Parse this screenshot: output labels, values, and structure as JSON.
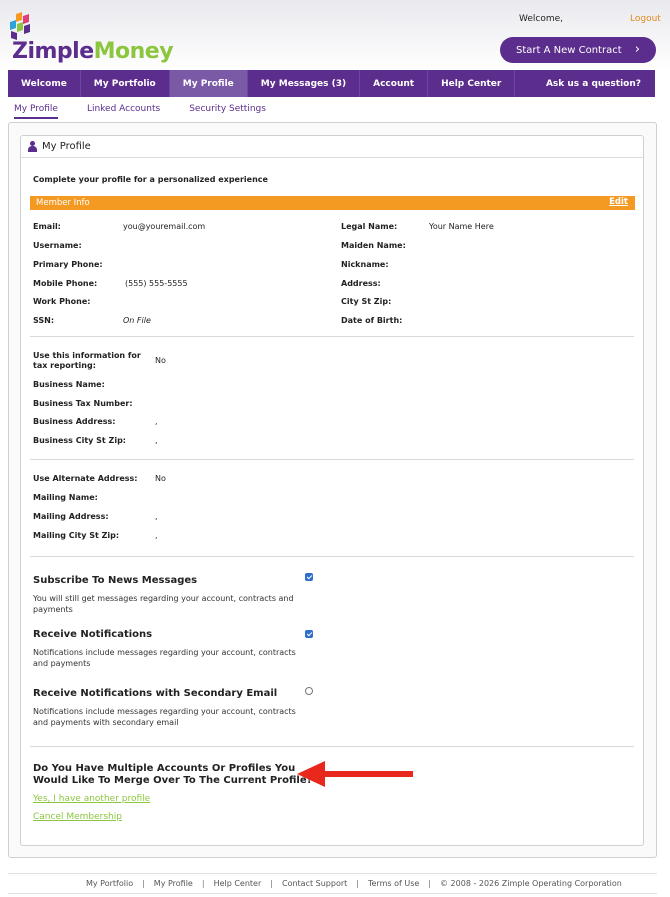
{
  "brand": {
    "name_part1": "Zimple",
    "name_part2": "Money",
    "colors": {
      "purple": "#5b2d8c",
      "green": "#8cc63f",
      "orange": "#f49a22",
      "link_orange": "#e08a1e"
    }
  },
  "header": {
    "welcome": "Welcome,",
    "logout": "Logout",
    "start_contract": "Start A New Contract",
    "start_icon": "chevron-right-icon"
  },
  "nav": {
    "items": [
      {
        "label": "Welcome"
      },
      {
        "label": "My Portfolio"
      },
      {
        "label": "My Profile",
        "active": true
      },
      {
        "label": "My Messages (3)"
      },
      {
        "label": "Account"
      },
      {
        "label": "Help Center"
      }
    ],
    "ask": "Ask us a question?"
  },
  "subtabs": [
    {
      "label": "My Profile",
      "active": true
    },
    {
      "label": "Linked Accounts"
    },
    {
      "label": "Security Settings"
    }
  ],
  "card": {
    "title": "My Profile",
    "icon": "user-icon",
    "intro": "Complete your profile for a personalized experience",
    "member_bar": {
      "label": "Member Info",
      "edit": "Edit"
    }
  },
  "member_left": [
    {
      "label": "Email:",
      "value": "you@youremail.com"
    },
    {
      "label": "Username:",
      "value": ""
    },
    {
      "label": "Primary Phone:",
      "value": ""
    },
    {
      "label": "Mobile Phone:",
      "value": "(555) 555-5555"
    },
    {
      "label": "Work Phone:",
      "value": ""
    },
    {
      "label": "SSN:",
      "value": "On File"
    }
  ],
  "member_right": [
    {
      "label": "Legal Name:",
      "value": "Your Name Here"
    },
    {
      "label": "Maiden Name:",
      "value": ""
    },
    {
      "label": "Nickname:",
      "value": ""
    },
    {
      "label": "Address:",
      "value": ""
    },
    {
      "label": "City St Zip:",
      "value": ""
    },
    {
      "label": "Date of Birth:",
      "value": ""
    }
  ],
  "business": [
    {
      "label": "Use this information for tax reporting:",
      "value": "No"
    },
    {
      "label": "Business Name:",
      "value": ""
    },
    {
      "label": "Business Tax Number:",
      "value": ""
    },
    {
      "label": "Business Address:",
      "value": ","
    },
    {
      "label": "Business City St Zip:",
      "value": ","
    }
  ],
  "mailing": [
    {
      "label": "Use Alternate Address:",
      "value": "No"
    },
    {
      "label": "Mailing Name:",
      "value": ""
    },
    {
      "label": "Mailing Address:",
      "value": ","
    },
    {
      "label": "Mailing City St Zip:",
      "value": ","
    }
  ],
  "prefs": [
    {
      "title": "Subscribe To News Messages",
      "desc": "You will still get messages regarding your account, contracts and payments",
      "checked": true
    },
    {
      "title": "Receive Notifications",
      "desc": "Notifications include messages regarding your account, contracts and payments",
      "checked": true
    },
    {
      "title": "Receive Notifications with Secondary Email",
      "desc": "Notifications include messages regarding your account, contracts and payments with secondary email",
      "checked": false
    }
  ],
  "merge": {
    "question": "Do You Have Multiple Accounts Or Profiles You Would Like To Merge Over To The Current Profile?",
    "yes_link": "Yes, I have another profile",
    "cancel_link": "Cancel Membership",
    "arrow_color": "#e8281c"
  },
  "footer": {
    "links": [
      "My Portfolio",
      "My Profile",
      "Help Center",
      "Contact Support",
      "Terms of Use"
    ],
    "copyright": "© 2008 - 2026 Zimple Operating Corporation"
  }
}
